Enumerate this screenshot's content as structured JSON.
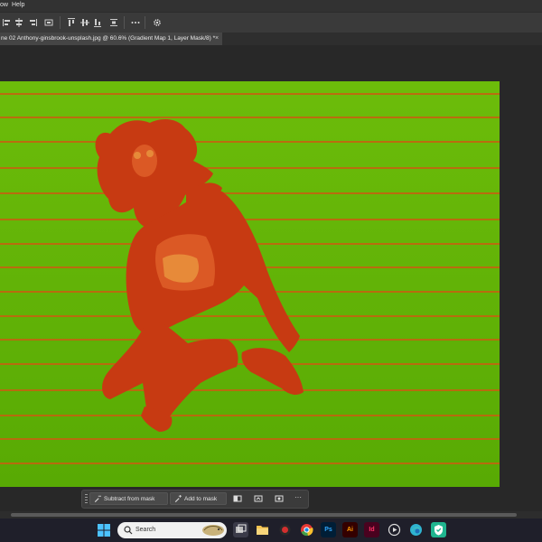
{
  "menubar": {
    "items": [
      "ow",
      "Help"
    ]
  },
  "document_tab": {
    "title": "ne 02 Anthony-ginsbrook-unsplash.jpg @ 60.6% (Gradient Map 1, Layer Mask/8) *",
    "close": "×"
  },
  "options_bar": {
    "icons": [
      "align-left-icon",
      "align-center-icon",
      "align-right-icon",
      "align-top-icon",
      "align-middle-icon",
      "align-bottom-icon",
      "distribute-icon",
      "more-icon",
      "gear-icon"
    ]
  },
  "canvas": {
    "effect": "Gradient Map",
    "colors": {
      "green": "#62b406",
      "red": "#c93a12",
      "line": "#d06a10"
    }
  },
  "context_bar": {
    "subtract_label": "Subtract from mask",
    "add_label": "Add to mask",
    "more": "···"
  },
  "windows_taskbar": {
    "search_label": "Search",
    "apps": [
      {
        "name": "file-explorer",
        "color": "#f2c14e"
      },
      {
        "name": "chrome",
        "color": "#e53935"
      },
      {
        "name": "photoshop",
        "label": "Ps",
        "color": "#31a8ff"
      },
      {
        "name": "illustrator",
        "label": "Ai",
        "color": "#ff9a00"
      },
      {
        "name": "indesign",
        "label": "Id",
        "color": "#ff3366"
      },
      {
        "name": "edge",
        "color": "#2fb4d1"
      }
    ]
  }
}
